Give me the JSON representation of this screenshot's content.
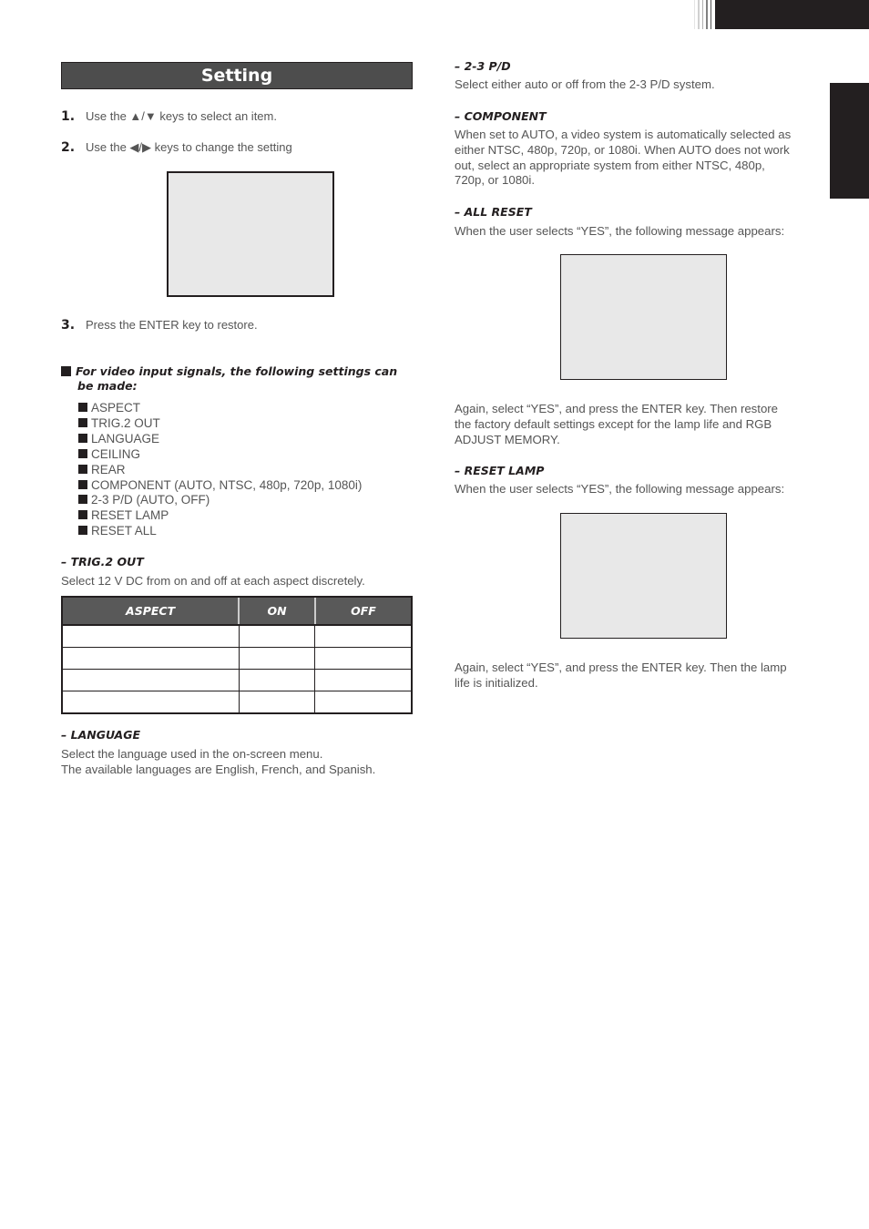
{
  "header": {
    "section_title": "Setting"
  },
  "steps": [
    {
      "num": "1.",
      "text": "Use the ▲/▼ keys to select an item."
    },
    {
      "num": "2.",
      "text": "Use the ◀/▶ keys to change the setting"
    },
    {
      "num": "3.",
      "text": "Press the ENTER key to restore."
    }
  ],
  "video_settings": {
    "heading_line1": "For video input signals, the following settings can",
    "heading_line2": "be made:",
    "items": [
      "ASPECT",
      "TRIG.2 OUT",
      "LANGUAGE",
      "CEILING",
      "REAR",
      "COMPONENT (AUTO, NTSC, 480p, 720p, 1080i)",
      "2-3 P/D (AUTO, OFF)",
      "RESET LAMP",
      "RESET ALL"
    ]
  },
  "trig2": {
    "heading": "–  TRIG.2 OUT",
    "text": "Select 12 V DC from on and off at each aspect discretely.",
    "table": {
      "headers": [
        "ASPECT",
        "ON",
        "OFF"
      ],
      "rows": [
        [
          "",
          "",
          ""
        ],
        [
          "",
          "",
          ""
        ],
        [
          "",
          "",
          ""
        ],
        [
          "",
          "",
          ""
        ]
      ]
    }
  },
  "language": {
    "heading": "–  LANGUAGE",
    "line1": "Select the language used in the on-screen menu.",
    "line2": "The available languages are English, French, and Spanish."
  },
  "pd23": {
    "heading": "–  2-3 P/D",
    "text": "Select either auto or off from the 2-3 P/D system."
  },
  "component": {
    "heading": "–  COMPONENT",
    "lines": [
      "When set to AUTO, a video system is automatically selected as",
      "either NTSC, 480p, 720p, or 1080i. When AUTO does not work",
      "out, select an appropriate system from either NTSC, 480p,",
      "720p, or 1080i."
    ]
  },
  "all_reset": {
    "heading": "–  ALL RESET",
    "intro": "When the user selects “YES”, the following message appears:",
    "after": [
      "Again, select “YES”, and press the ENTER key. Then restore",
      "the factory default settings except for the lamp life and RGB",
      "ADJUST MEMORY."
    ]
  },
  "reset_lamp": {
    "heading": "–  RESET LAMP",
    "intro": "When the user selects “YES”, the following message appears:",
    "after": [
      "Again, select “YES”, and press the ENTER key. Then the lamp",
      "life is initialized."
    ]
  }
}
